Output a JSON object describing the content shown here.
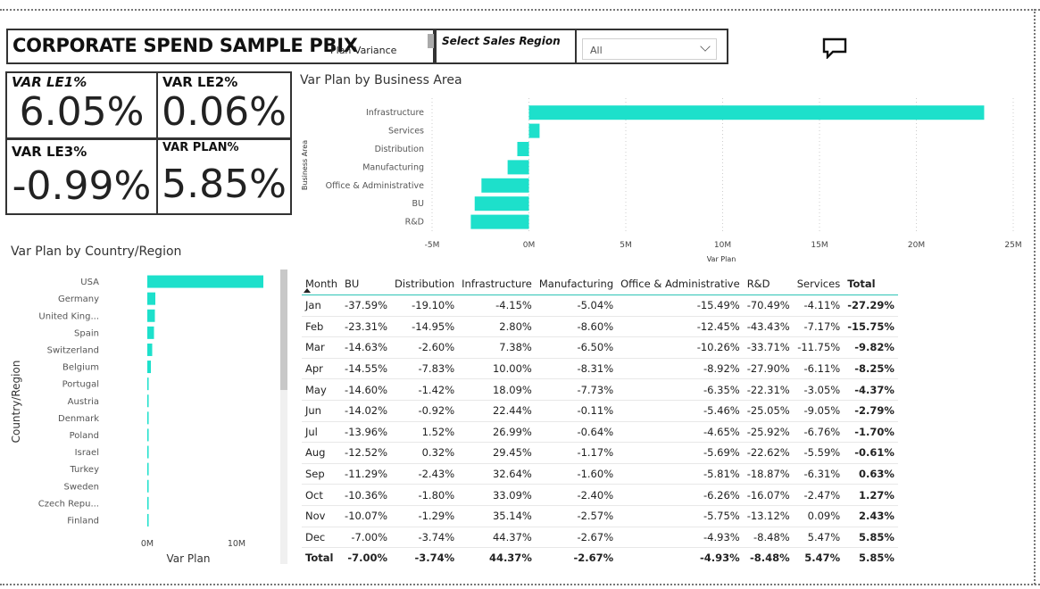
{
  "header": {
    "title": "CORPORATE SPEND SAMPLE PBIX",
    "subtitle": "Plan Variance",
    "region_label": "Select Sales Region",
    "region_value": "All",
    "comment_icon": "comment-icon"
  },
  "kpis": [
    {
      "label": "VAR LE1%",
      "value": "6.05%"
    },
    {
      "label": "VAR LE2%",
      "value": "0.06%"
    },
    {
      "label": "VAR LE3%",
      "value": "-0.99%"
    },
    {
      "label": "VAR PLAN%",
      "value": "5.85%"
    }
  ],
  "colors": {
    "accent": "#1de0cb"
  },
  "business_chart": {
    "title": "Var Plan by Business Area",
    "ylabel": "Business Area",
    "xlabel": "Var Plan",
    "chart_data": {
      "type": "bar",
      "orientation": "horizontal",
      "categories": [
        "Infrastructure",
        "Services",
        "Distribution",
        "Manufacturing",
        "Office & Administrative",
        "BU",
        "R&D"
      ],
      "values": [
        23.5,
        0.55,
        -0.6,
        -1.1,
        -2.45,
        -2.8,
        -3.0
      ],
      "unit": "M",
      "xlim": [
        -5,
        25
      ],
      "xticks": [
        "-5M",
        "0M",
        "5M",
        "10M",
        "15M",
        "20M",
        "25M"
      ],
      "tick_values": [
        -5,
        0,
        5,
        10,
        15,
        20,
        25
      ]
    }
  },
  "country_chart": {
    "title": "Var Plan by Country/Region",
    "ylabel": "Country/Region",
    "xlabel": "Var Plan",
    "chart_data": {
      "type": "bar",
      "orientation": "horizontal",
      "categories": [
        "USA",
        "Germany",
        "United King...",
        "Spain",
        "Switzerland",
        "Belgium",
        "Portugal",
        "Austria",
        "Denmark",
        "Poland",
        "Israel",
        "Turkey",
        "Sweden",
        "Czech Repu...",
        "Finland"
      ],
      "values": [
        13.0,
        0.9,
        0.85,
        0.75,
        0.55,
        0.4,
        0.15,
        0.12,
        0.1,
        0.1,
        0.08,
        0.08,
        0.06,
        0.05,
        0.05
      ],
      "unit": "M",
      "xlim": [
        0,
        14
      ],
      "xticks": [
        "0M",
        "10M"
      ],
      "tick_values": [
        0,
        10
      ]
    }
  },
  "table": {
    "columns": [
      "Month",
      "BU",
      "Distribution",
      "Infrastructure",
      "Manufacturing",
      "Office & Administrative",
      "R&D",
      "Services",
      "Total"
    ],
    "rows": [
      [
        "Jan",
        "-37.59%",
        "-19.10%",
        "-4.15%",
        "-5.04%",
        "-15.49%",
        "-70.49%",
        "-4.11%",
        "-27.29%"
      ],
      [
        "Feb",
        "-23.31%",
        "-14.95%",
        "2.80%",
        "-8.60%",
        "-12.45%",
        "-43.43%",
        "-7.17%",
        "-15.75%"
      ],
      [
        "Mar",
        "-14.63%",
        "-2.60%",
        "7.38%",
        "-6.50%",
        "-10.26%",
        "-33.71%",
        "-11.75%",
        "-9.82%"
      ],
      [
        "Apr",
        "-14.55%",
        "-7.83%",
        "10.00%",
        "-8.31%",
        "-8.92%",
        "-27.90%",
        "-6.11%",
        "-8.25%"
      ],
      [
        "May",
        "-14.60%",
        "-1.42%",
        "18.09%",
        "-7.73%",
        "-6.35%",
        "-22.31%",
        "-3.05%",
        "-4.37%"
      ],
      [
        "Jun",
        "-14.02%",
        "-0.92%",
        "22.44%",
        "-0.11%",
        "-5.46%",
        "-25.05%",
        "-9.05%",
        "-2.79%"
      ],
      [
        "Jul",
        "-13.96%",
        "1.52%",
        "26.99%",
        "-0.64%",
        "-4.65%",
        "-25.92%",
        "-6.76%",
        "-1.70%"
      ],
      [
        "Aug",
        "-12.52%",
        "0.32%",
        "29.45%",
        "-1.17%",
        "-5.69%",
        "-22.62%",
        "-5.59%",
        "-0.61%"
      ],
      [
        "Sep",
        "-11.29%",
        "-2.43%",
        "32.64%",
        "-1.60%",
        "-5.81%",
        "-18.87%",
        "-6.31%",
        "0.63%"
      ],
      [
        "Oct",
        "-10.36%",
        "-1.80%",
        "33.09%",
        "-2.40%",
        "-6.26%",
        "-16.07%",
        "-2.47%",
        "1.27%"
      ],
      [
        "Nov",
        "-10.07%",
        "-1.29%",
        "35.14%",
        "-2.57%",
        "-5.75%",
        "-13.12%",
        "0.09%",
        "2.43%"
      ],
      [
        "Dec",
        "-7.00%",
        "-3.74%",
        "44.37%",
        "-2.67%",
        "-4.93%",
        "-8.48%",
        "5.47%",
        "5.85%"
      ]
    ],
    "total_row": [
      "Total",
      "-7.00%",
      "-3.74%",
      "44.37%",
      "-2.67%",
      "-4.93%",
      "-8.48%",
      "5.47%",
      "5.85%"
    ]
  }
}
